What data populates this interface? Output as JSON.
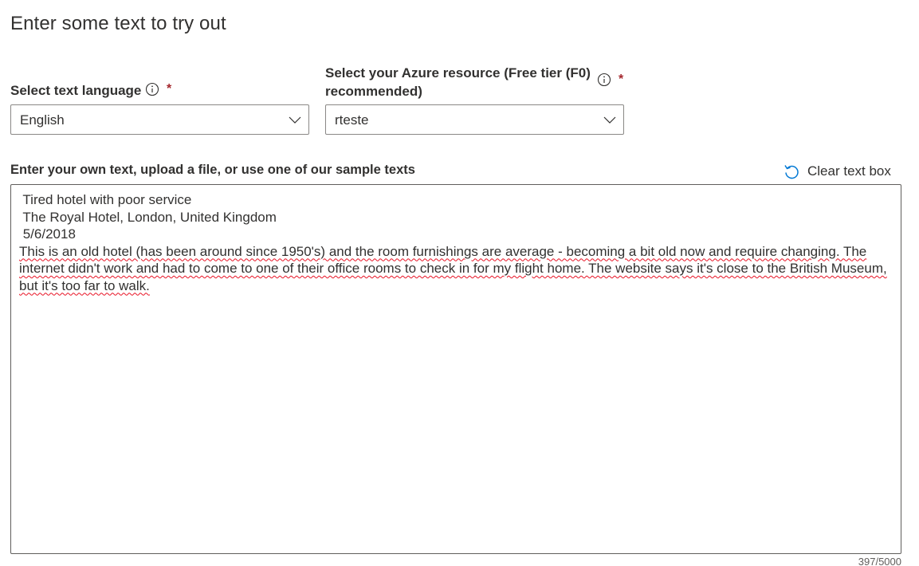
{
  "heading": "Enter some text to try out",
  "language": {
    "label": "Select text language",
    "required_mark": "*",
    "selected": "English"
  },
  "resource": {
    "label_line1": "Select your Azure resource (Free tier (F0)",
    "label_line2": "recommended)",
    "required_mark": "*",
    "selected": "rteste"
  },
  "text_input": {
    "label": "Enter your own text, upload a file, or use one of our sample texts",
    "clear_label": "Clear text box",
    "lines": [
      " Tired hotel with poor service",
      " The Royal Hotel, London, United Kingdom",
      " 5/6/2018"
    ],
    "paragraph": " This is an old hotel (has been around since 1950's) and the room furnishings are average - becoming a bit old now and require changing. The internet didn't work and had to come to one of their office rooms to check in for my flight home. The website says it's close to the British Museum, but it's too far to walk.",
    "counter": "397/5000"
  },
  "colors": {
    "required": "#a4262c",
    "icon_blue": "#0078d4",
    "spellcheck": "#e81123",
    "text": "#323130"
  }
}
